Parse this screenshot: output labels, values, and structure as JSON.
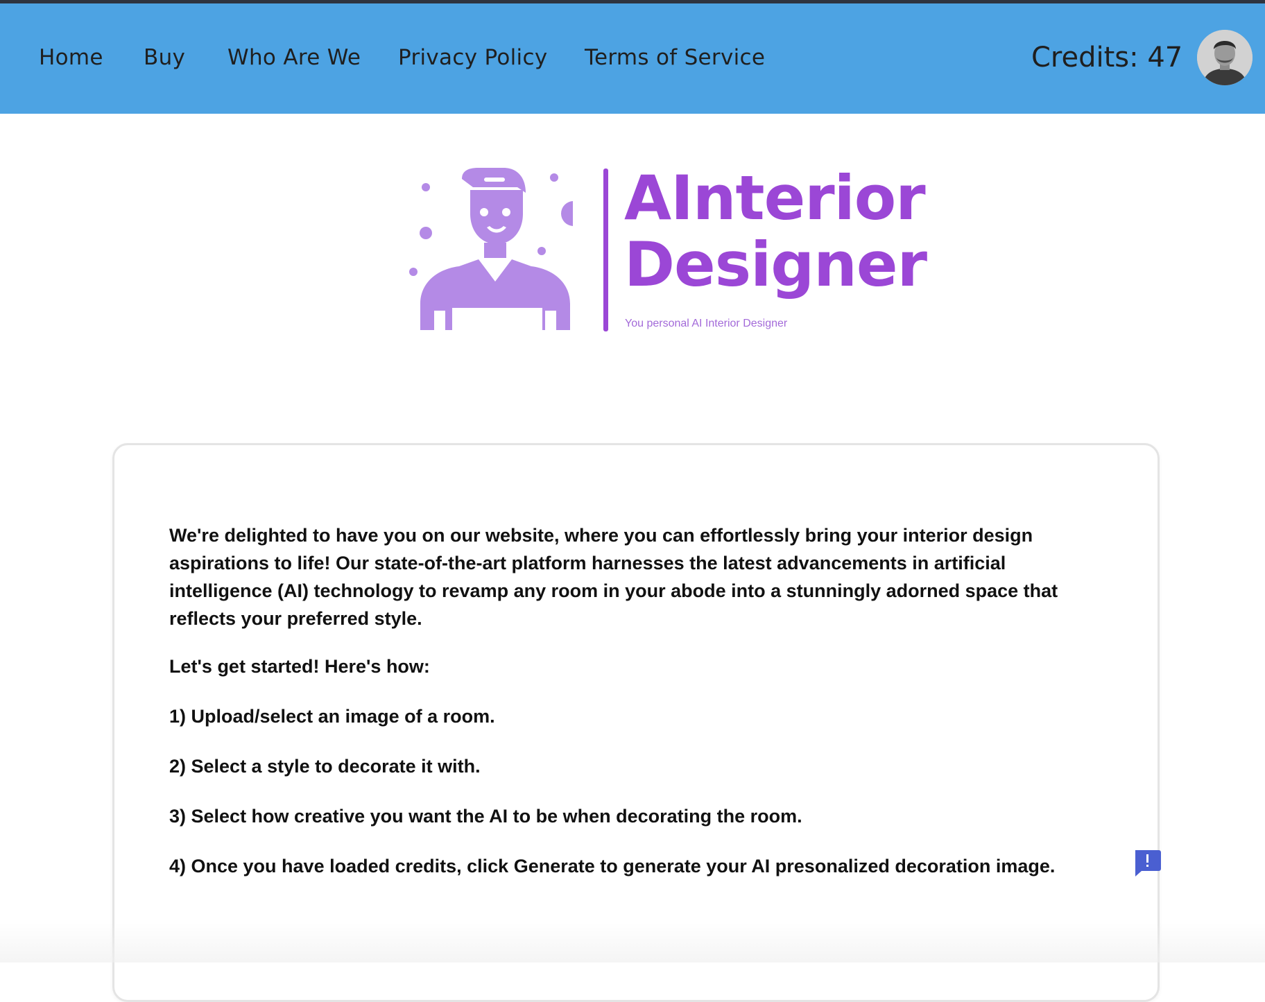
{
  "nav": {
    "links": [
      "Home",
      "Buy",
      "Who Are We",
      "Privacy Policy",
      "Terms of Service"
    ],
    "credits": "Credits: 47"
  },
  "logo": {
    "title_line1": "AInterior",
    "title_line2": "Designer",
    "tagline": "You personal AI Interior Designer",
    "color": "#9b47d6",
    "icon": "designer-person-icon"
  },
  "content": {
    "intro": "We're delighted to have you on our website, where you can effortlessly bring your interior design aspirations to life! Our state-of-the-art platform harnesses the latest advancements in artificial intelligence (AI) technology to revamp any room in your abode into a stunningly adorned space that reflects your preferred style.",
    "lead": "Let's get started! Here's how:",
    "steps": [
      "1) Upload/select an image of a room.",
      "2) Select a style to decorate it with.",
      "3) Select how creative you want the AI to be when decorating the room.",
      "4) Once you have loaded credits, click Generate to generate your AI presonalized decoration image."
    ]
  },
  "colors": {
    "navbar": "#4da3e3",
    "feedback": "#4a5fd1"
  },
  "feedback_icon": "feedback-icon"
}
